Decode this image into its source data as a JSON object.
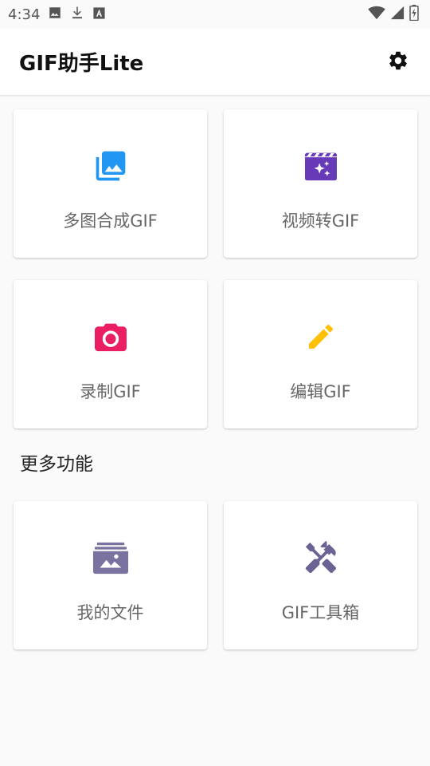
{
  "status_bar": {
    "time": "4:34",
    "left_icons": [
      "image-icon",
      "download-icon",
      "text-box-icon"
    ],
    "right_icons": [
      "wifi-icon",
      "cell-signal-icon",
      "battery-charging-icon"
    ]
  },
  "app_bar": {
    "title": "GIF助手Lite",
    "settings_icon": "gear-icon"
  },
  "main_features": [
    {
      "label": "多图合成GIF",
      "icon": "photo-library-icon",
      "color": "#2196f3"
    },
    {
      "label": "视频转GIF",
      "icon": "movie-sparkle-icon",
      "color": "#673ab7"
    },
    {
      "label": "录制GIF",
      "icon": "camera-icon",
      "color": "#e91e63"
    },
    {
      "label": "编辑GIF",
      "icon": "pencil-icon",
      "color": "#ffc107"
    }
  ],
  "more_section": {
    "title": "更多功能",
    "items": [
      {
        "label": "我的文件",
        "icon": "image-folder-icon",
        "color": "#7b739f"
      },
      {
        "label": "GIF工具箱",
        "icon": "tools-icon",
        "color": "#6a6394"
      }
    ]
  }
}
